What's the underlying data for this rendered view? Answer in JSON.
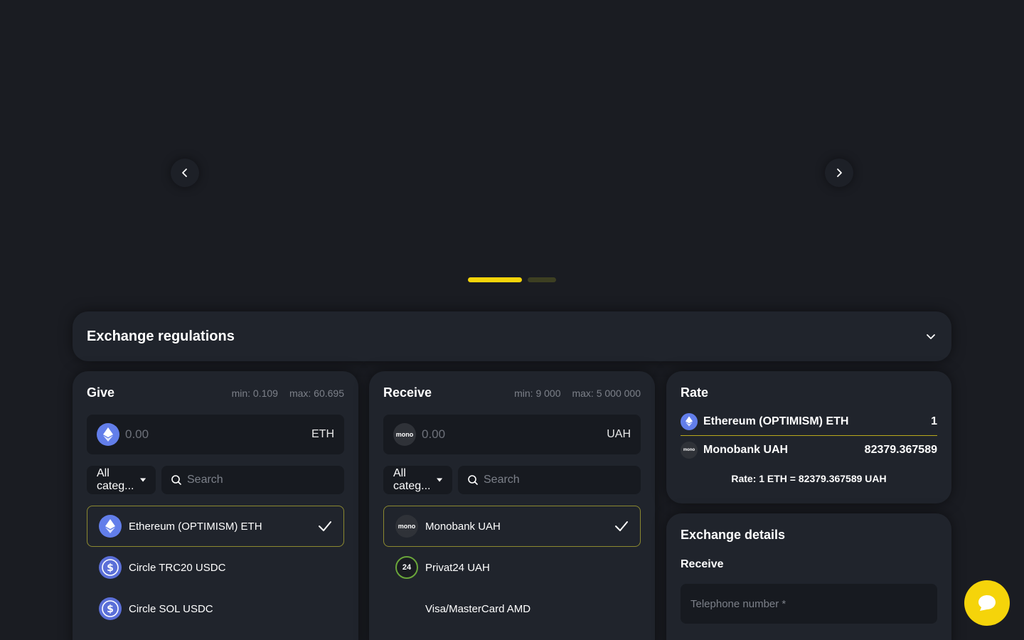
{
  "colors": {
    "accent": "#f5d40a",
    "background": "#1a1c22",
    "card": "#20242c",
    "input": "#171a20"
  },
  "slider": {
    "dots": [
      {
        "active": true
      },
      {
        "active": false
      }
    ]
  },
  "regulations": {
    "title": "Exchange regulations"
  },
  "give": {
    "title": "Give",
    "min": "min: 0.109",
    "max": "max: 60.695",
    "amount_placeholder": "0.00",
    "currency": "ETH",
    "category": "All categ...",
    "search_placeholder": "Search",
    "items": [
      {
        "label": "Ethereum (OPTIMISM) ETH",
        "icon": "ethereum-icon",
        "selected": true
      },
      {
        "label": "Circle TRC20 USDC",
        "icon": "usdc-icon",
        "selected": false
      },
      {
        "label": "Circle SOL USDC",
        "icon": "usdc-icon",
        "selected": false
      }
    ]
  },
  "receive": {
    "title": "Receive",
    "min": "min: 9 000",
    "max": "max: 5 000 000",
    "amount_placeholder": "0.00",
    "currency": "UAH",
    "category": "All categ...",
    "search_placeholder": "Search",
    "items": [
      {
        "label": "Monobank UAH",
        "icon": "monobank-icon",
        "icon_text": "mono",
        "selected": true
      },
      {
        "label": "Privat24 UAH",
        "icon": "privat24-icon",
        "icon_text": "24",
        "selected": false
      },
      {
        "label": "Visa/MasterCard AMD",
        "icon": "none",
        "selected": false
      }
    ]
  },
  "rate": {
    "title": "Rate",
    "from_name": "Ethereum (OPTIMISM) ETH",
    "from_value": "1",
    "to_icon_text": "mono",
    "to_name": "Monobank UAH",
    "to_value": "82379.367589",
    "summary": "Rate: 1 ETH = 82379.367589 UAH"
  },
  "details": {
    "title": "Exchange details",
    "subtitle": "Receive",
    "phone_placeholder": "Telephone number *"
  }
}
